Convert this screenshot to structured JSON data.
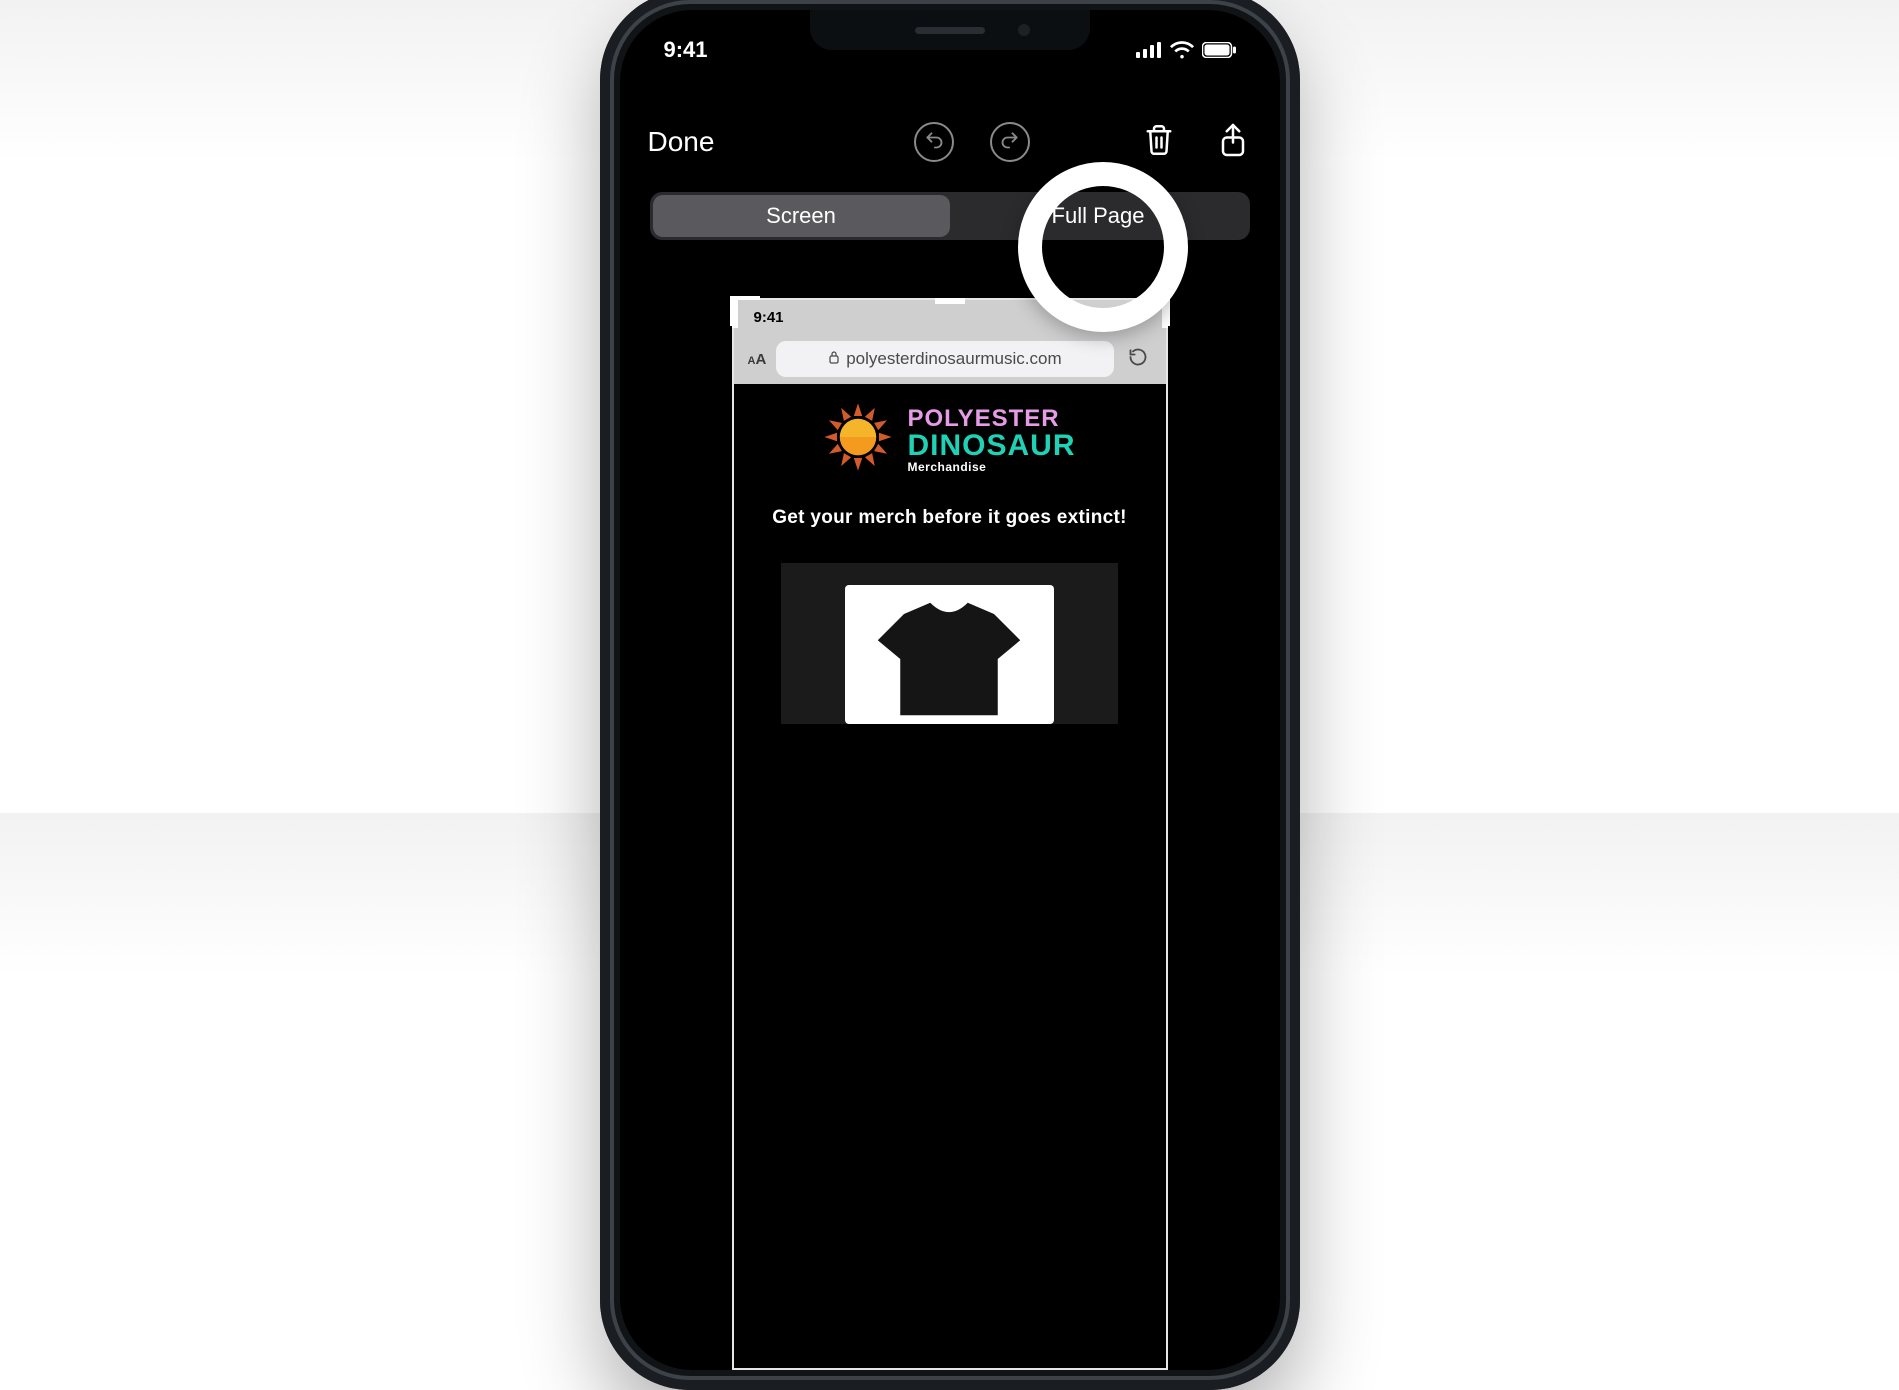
{
  "status_bar": {
    "time": "9:41"
  },
  "markup": {
    "done_label": "Done",
    "segmented": {
      "screen_label": "Screen",
      "fullpage_label": "Full Page"
    }
  },
  "safari_preview": {
    "status_time": "9:41",
    "url_text": "polyesterdinosaurmusic.com",
    "brand": {
      "line1": "POLYESTER",
      "line2": "DINOSAUR",
      "line3": "Merchandise"
    },
    "tagline": "Get your merch before it goes extinct!"
  }
}
